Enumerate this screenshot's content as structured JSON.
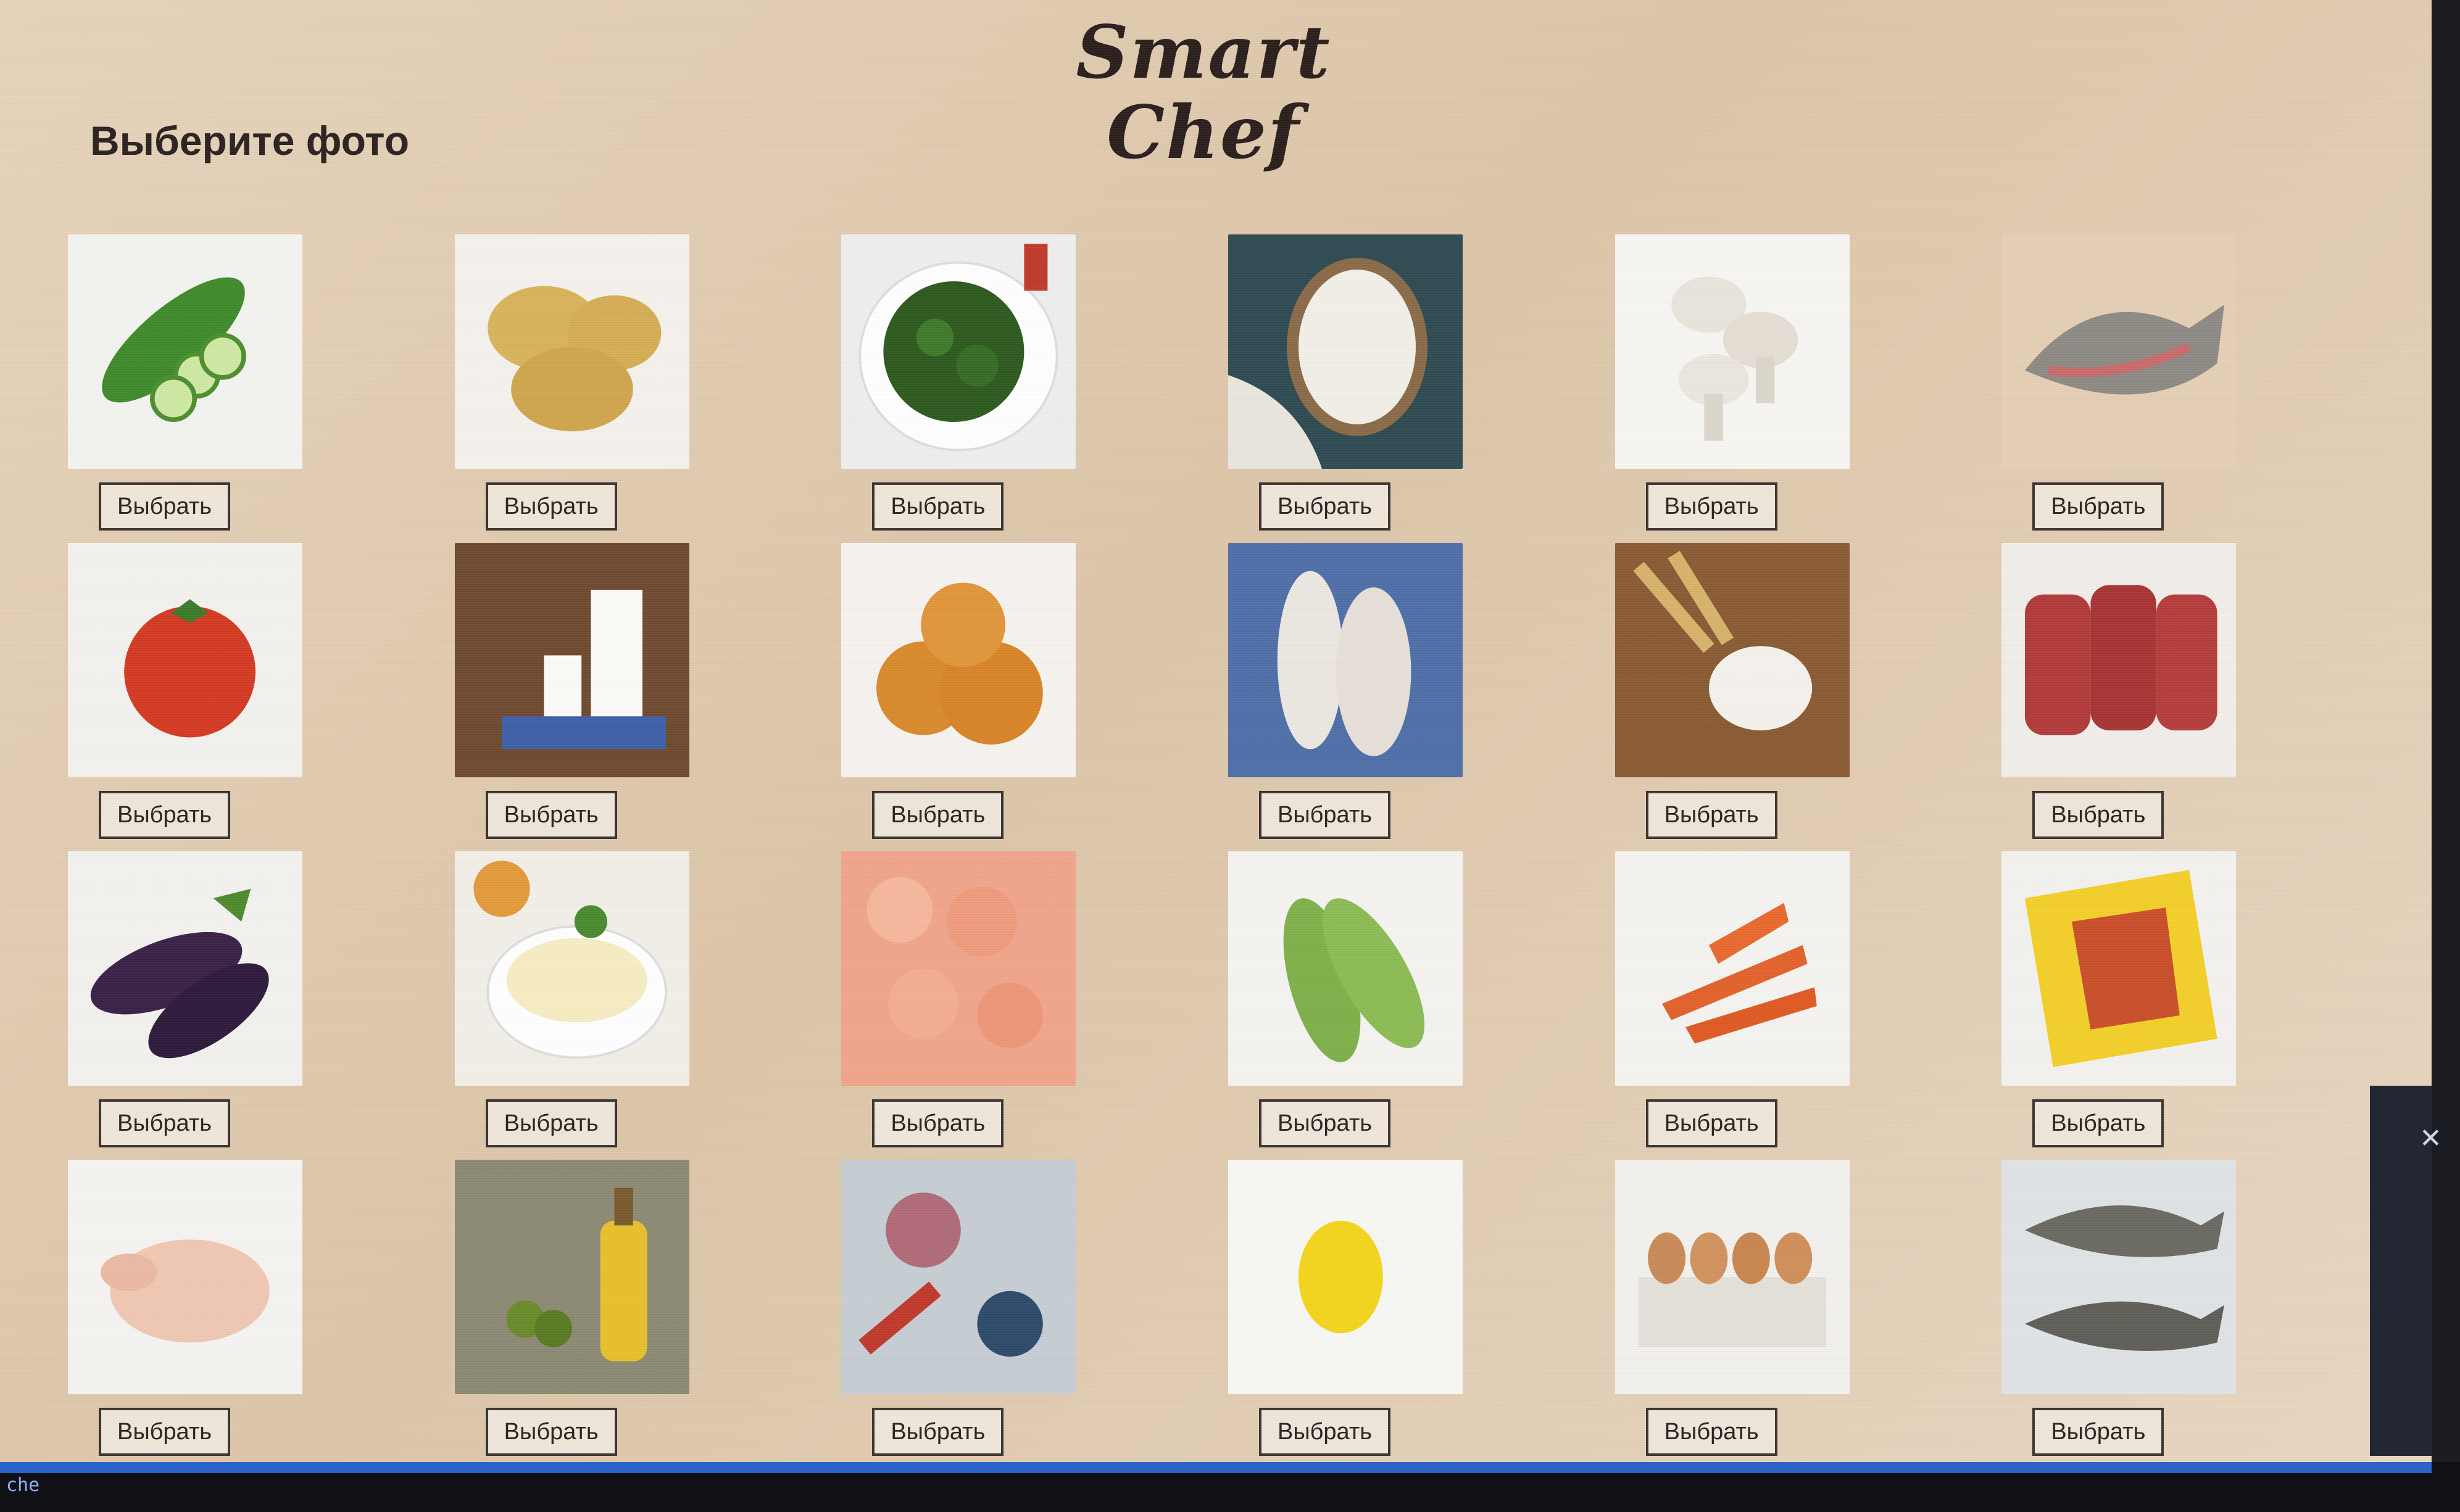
{
  "header": {
    "brand": "Smart Chef",
    "heading": "Выберите фото"
  },
  "ingredients": [
    {
      "icon": "cucumber-icon",
      "button": "Выбрать"
    },
    {
      "icon": "potato-icon",
      "button": "Выбрать"
    },
    {
      "icon": "greens-icon",
      "button": "Выбрать"
    },
    {
      "icon": "rice-icon",
      "button": "Выбрать"
    },
    {
      "icon": "mushroom-icon",
      "button": "Выбрать"
    },
    {
      "icon": "trout-icon",
      "button": "Выбрать"
    },
    {
      "icon": "tomato-icon",
      "button": "Выбрать"
    },
    {
      "icon": "milk-icon",
      "button": "Выбрать"
    },
    {
      "icon": "onion-icon",
      "button": "Выбрать"
    },
    {
      "icon": "fish-fillet-icon",
      "button": "Выбрать"
    },
    {
      "icon": "flour-icon",
      "button": "Выбрать"
    },
    {
      "icon": "beef-icon",
      "button": "Выбрать"
    },
    {
      "icon": "eggplant-icon",
      "button": "Выбрать"
    },
    {
      "icon": "mayonnaise-icon",
      "button": "Выбрать"
    },
    {
      "icon": "shrimp-icon",
      "button": "Выбрать"
    },
    {
      "icon": "zucchini-icon",
      "button": "Выбрать"
    },
    {
      "icon": "carrot-icon",
      "button": "Выбрать"
    },
    {
      "icon": "pasta-icon",
      "button": "Выбрать"
    },
    {
      "icon": "chicken-icon",
      "button": "Выбрать"
    },
    {
      "icon": "olive-oil-icon",
      "button": "Выбрать"
    },
    {
      "icon": "seafood-icon",
      "button": "Выбрать"
    },
    {
      "icon": "lemon-icon",
      "button": "Выбрать"
    },
    {
      "icon": "eggs-icon",
      "button": "Выбрать"
    },
    {
      "icon": "cod-icon",
      "button": "Выбрать"
    }
  ],
  "taskbar": {
    "tag": "che"
  },
  "colors": {
    "background": "#e3cfb6",
    "button_border": "#3a3330",
    "brand_text": "#2a1f1c"
  }
}
